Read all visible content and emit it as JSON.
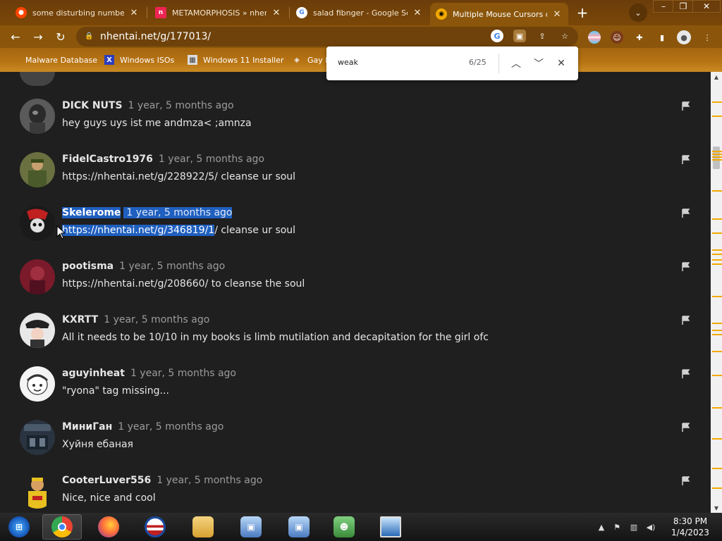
{
  "browser": {
    "tabs": [
      {
        "label": "some disturbing numbers",
        "favicon": "reddit-icon",
        "color": "#ff4500",
        "active": false
      },
      {
        "label": "METAMORPHOSIS » nhentai",
        "favicon": "nhentai-icon",
        "color": "#ed2553",
        "active": false
      },
      {
        "label": "salad fibnger - Google Search",
        "favicon": "google-icon",
        "color": "#4285f4",
        "active": false
      },
      {
        "label": "Multiple Mouse Cursors on",
        "favicon": "mouse-icon",
        "color": "#f2a900",
        "active": true
      }
    ],
    "url": "nhentai.net/g/177013/",
    "bookmarks": [
      {
        "label": "Malware Database"
      },
      {
        "label": "Windows ISOs"
      },
      {
        "label": "Windows 11 Installer"
      },
      {
        "label": "Gay h"
      }
    ]
  },
  "find_bar": {
    "query": "weak",
    "count": "6/25"
  },
  "comments": [
    {
      "username": "DICK NUTS",
      "time": "1 year, 5 months ago",
      "body": "hey guys uys ist me andmza< ;amnza",
      "avatar_color": "#6a6a6a"
    },
    {
      "username": "FidelCastro1976",
      "time": "1 year, 5 months ago",
      "body": "https://nhentai.net/g/228922/5/ cleanse ur soul",
      "avatar_color": "#7a7a3a"
    },
    {
      "username": "Skelerome",
      "time": "1 year, 5 months ago",
      "body_selected": "https://nhentai.net/g/346819/1",
      "body_rest": "/ cleanse ur soul",
      "avatar_color": "#3a3a3a",
      "selected": true
    },
    {
      "username": "pootisma",
      "time": "1 year, 5 months ago",
      "body": "https://nhentai.net/g/208660/ to cleanse the soul",
      "avatar_color": "#8a2a3a"
    },
    {
      "username": "KXRTT",
      "time": "1 year, 5 months ago",
      "body": "All it needs to be 10/10 in my books is limb mutilation and decapitation for the girl ofc",
      "avatar_color": "#d8d8d8"
    },
    {
      "username": "aguyinheat",
      "time": "1 year, 5 months ago",
      "body": "\"ryona\" tag missing...",
      "avatar_color": "#eeeeee"
    },
    {
      "username": "МиниГан",
      "time": "1 year, 5 months ago",
      "body": "Хуйня ебаная",
      "avatar_color": "#4a5a6a"
    },
    {
      "username": "CooterLuver556",
      "time": "1 year, 5 months ago",
      "body": "Nice, nice and cool",
      "avatar_color": "#e0a020"
    }
  ],
  "taskbar": {
    "time": "8:30 PM",
    "date": "1/4/2023"
  },
  "colors": {
    "accent": "#8b560b",
    "selection": "#1f5fbf",
    "find_marker": "#f2a900"
  }
}
